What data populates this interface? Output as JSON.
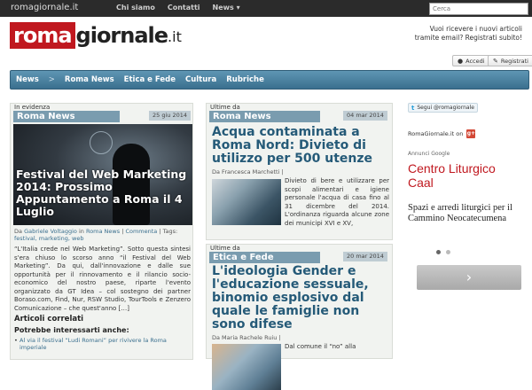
{
  "topbar": {
    "site": "romagiornale.it",
    "nav": [
      "Chi siamo",
      "Contatti",
      "News ▾"
    ],
    "search_placeholder": "Cerca"
  },
  "header": {
    "logo_roma": "roma",
    "logo_giornale": "giornale",
    "logo_it": ".it",
    "subscribe_text": "Vuoi ricevere i nuovi articoli tramite email? Registrati subito!",
    "login_label": "Accedi",
    "register_label": "Registrati"
  },
  "mainnav": {
    "items": [
      "News",
      ">",
      "Roma News",
      "Etica e Fede",
      "Cultura",
      "Rubriche"
    ]
  },
  "featured": {
    "kicker": "In evidenza",
    "section": "Roma News",
    "date": "25 giu 2014",
    "title": "Festival del Web Marketing 2014: Prossimo Appuntamento a Roma il 4 Luglio",
    "byline_prefix": "Da",
    "author": "Gabriele Voltaggio",
    "byline_in": "in",
    "category": "Roma News",
    "comments": "Commenta",
    "tags_label": "Tags:",
    "tags": "festival, marketing, web",
    "excerpt": "“L'Italia crede nel Web Marketing”. Sotto questa sintesi s'era chiuso lo scorso anno “il Festival del Web Marketing”. Da qui, dall'innovazione e dalle sue opportunità per il rinnovamento e il rilancio socio-economico del nostro paese, riparte l'evento organizzato da GT Idea – col sostegno dei partner Boraso.com, Find, Nur, RSW Studio, TourTools e Zenzero Comunicazione – che quest'anno […]",
    "related_heading": "Articoli correlati",
    "related_sub": "Potrebbe interessarti anche:",
    "related": [
      "Al via il festival “Ludi Romani” per rivivere la Roma imperiale"
    ]
  },
  "latest1": {
    "kicker": "Ultime da",
    "section": "Roma News",
    "date": "04 mar 2014",
    "title": "Acqua contaminata a Roma Nord: Divieto di utilizzo per 500 utenze",
    "byline": "Da Francesca Marchetti |",
    "excerpt": "Divieto di bere e utilizzare per scopi alimentari e igiene personale l'acqua di casa fino al 31 dicembre del 2014. L'ordinanza riguarda alcune zone dei municipi XVI e XV,"
  },
  "latest2": {
    "kicker": "Ultime da",
    "section": "Etica e Fede",
    "date": "20 mar 2014",
    "title": "L'ideologia Gender e l'educazione sessuale, binomio esplosivo dal quale le famiglie non sono difese",
    "byline": "Da Maria Rachele Ruiu |",
    "excerpt": "Dal comune il “no” alla"
  },
  "sidebar": {
    "twitter": "Segui @romagiornale",
    "gplus_label": "RomaGiornale.it on",
    "gplus_icon": "g+",
    "ad_label": "Annunci Google",
    "ad_title": "Centro Liturgico Caal",
    "ad_desc": "Spazi e arredi liturgici per il Cammino Neocatecumena",
    "ad_next": "›"
  }
}
